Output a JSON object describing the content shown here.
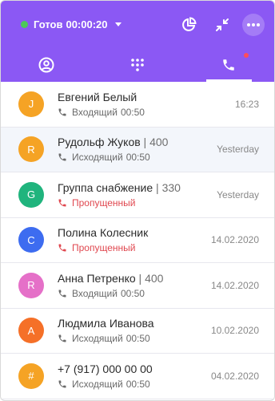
{
  "status": {
    "label": "Готов",
    "timer": "00:00:20",
    "dot_color": "#4cc95a"
  },
  "header": {
    "actions": [
      "pie-chart-icon",
      "collapse-icon",
      "more-icon"
    ]
  },
  "tabs": [
    {
      "icon": "user-icon",
      "active": false
    },
    {
      "icon": "dialpad-icon",
      "active": false
    },
    {
      "icon": "phone-icon",
      "active": true,
      "badge": true
    }
  ],
  "calls": [
    {
      "initial": "J",
      "color": "#f5a325",
      "name": "Евгений Белый",
      "ext": "",
      "type": "Входящий",
      "duration": "00:50",
      "missed": false,
      "date": "16:23"
    },
    {
      "initial": "R",
      "color": "#f5a325",
      "name": "Рудольф Жуков",
      "ext": "400",
      "type": "Исходящий",
      "duration": "00:50",
      "missed": false,
      "date": "Yesterday"
    },
    {
      "initial": "G",
      "color": "#20b47d",
      "name": "Группа снабжение",
      "ext": "330",
      "type": "Пропущенный",
      "duration": "",
      "missed": true,
      "date": "Yesterday"
    },
    {
      "initial": "C",
      "color": "#3d6cf0",
      "name": "Полина Колесник",
      "ext": "",
      "type": "Пропущенный",
      "duration": "",
      "missed": true,
      "date": "14.02.2020"
    },
    {
      "initial": "R",
      "color": "#e570c8",
      "name": "Анна Петренко",
      "ext": "400",
      "type": "Входящий",
      "duration": "00:50",
      "missed": false,
      "date": "14.02.2020"
    },
    {
      "initial": "A",
      "color": "#f57028",
      "name": "Людмила Иванова",
      "ext": "",
      "type": "Исходящий",
      "duration": "00:50",
      "missed": false,
      "date": "10.02.2020"
    },
    {
      "initial": "#",
      "color": "#f5a325",
      "name": "+7 (917) 000 00 00",
      "ext": "",
      "type": "Исходящий",
      "duration": "00:50",
      "missed": false,
      "date": "04.02.2020"
    }
  ]
}
